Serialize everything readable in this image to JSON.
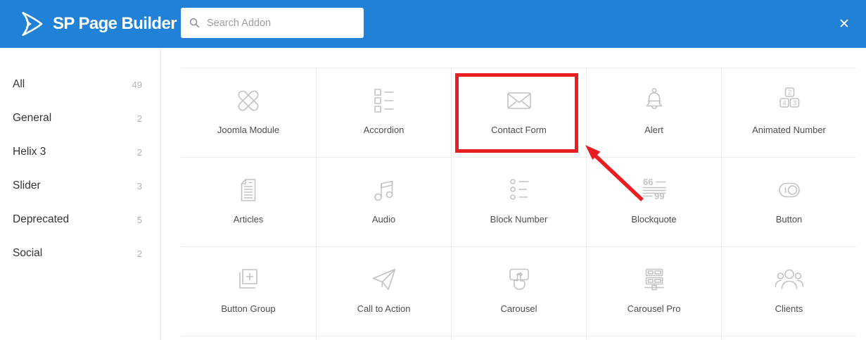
{
  "header": {
    "logo_text": "SP Page Builder",
    "search_placeholder": "Search Addon",
    "close_glyph": "✕"
  },
  "sidebar": {
    "items": [
      {
        "label": "All",
        "count": "49"
      },
      {
        "label": "General",
        "count": "2"
      },
      {
        "label": "Helix 3",
        "count": "2"
      },
      {
        "label": "Slider",
        "count": "3"
      },
      {
        "label": "Deprecated",
        "count": "5"
      },
      {
        "label": "Social",
        "count": "2"
      }
    ]
  },
  "addons": [
    {
      "label": "Joomla Module",
      "icon": "joomla-icon"
    },
    {
      "label": "Accordion",
      "icon": "accordion-list-icon"
    },
    {
      "label": "Contact Form",
      "icon": "envelope-icon",
      "highlighted": true
    },
    {
      "label": "Alert",
      "icon": "bell-icon"
    },
    {
      "label": "Animated Number",
      "icon": "number-blocks-icon"
    },
    {
      "label": "Articles",
      "icon": "document-icon"
    },
    {
      "label": "Audio",
      "icon": "music-notes-icon"
    },
    {
      "label": "Block Number",
      "icon": "bullet-list-icon"
    },
    {
      "label": "Blockquote",
      "icon": "quotes-icon"
    },
    {
      "label": "Button",
      "icon": "toggle-button-icon"
    },
    {
      "label": "Button Group",
      "icon": "plus-square-icon"
    },
    {
      "label": "Call to Action",
      "icon": "paper-plane-icon"
    },
    {
      "label": "Carousel",
      "icon": "swipe-hand-icon"
    },
    {
      "label": "Carousel Pro",
      "icon": "slider-panels-icon"
    },
    {
      "label": "Clients",
      "icon": "people-group-icon"
    }
  ],
  "annotation": {
    "highlighted_addon": "Contact Form",
    "shape": "red box around Contact Form card with red arrow pointing at its bottom-right corner"
  },
  "colors": {
    "header_blue": "#2181d6",
    "grid_line": "#ececec",
    "icon_gray": "#c2c2c2",
    "annotation_red": "#e81e23"
  }
}
